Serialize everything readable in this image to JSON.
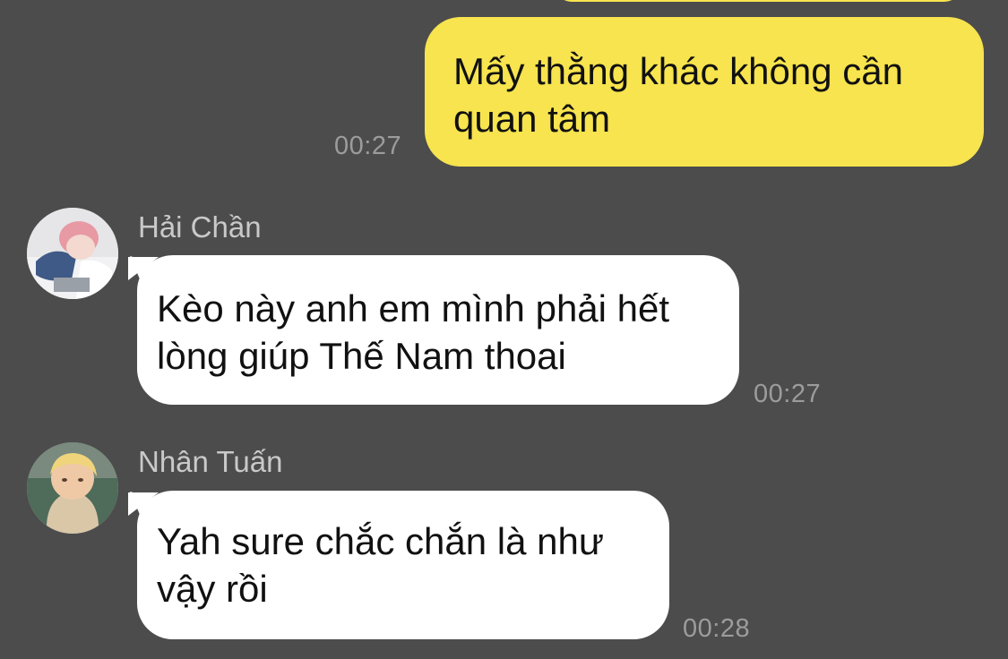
{
  "conversation": {
    "messages": [
      {
        "sender": "",
        "text_line1": "Mấy thằng khác không cần",
        "text_line2": "quan tâm",
        "time": "00:27"
      },
      {
        "sender": "Hải Chần",
        "text_line1": "Kèo này anh em mình phải hết",
        "text_line2": "lòng giúp Thế Nam thoai",
        "time": "00:27"
      },
      {
        "sender": "Nhân Tuấn",
        "text_line1": "Yah sure chắc chắn là như",
        "text_line2": "vậy rồi",
        "time": "00:28"
      }
    ]
  },
  "colors": {
    "background": "#4c4c4c",
    "own_bubble": "#f7e44e",
    "other_bubble": "#ffffff",
    "timestamp": "#9c9c9c",
    "sender_name": "#c9c9c9"
  },
  "icons": {
    "avatar_1": "avatar-hai-chan",
    "avatar_2": "avatar-nhan-tuan"
  }
}
